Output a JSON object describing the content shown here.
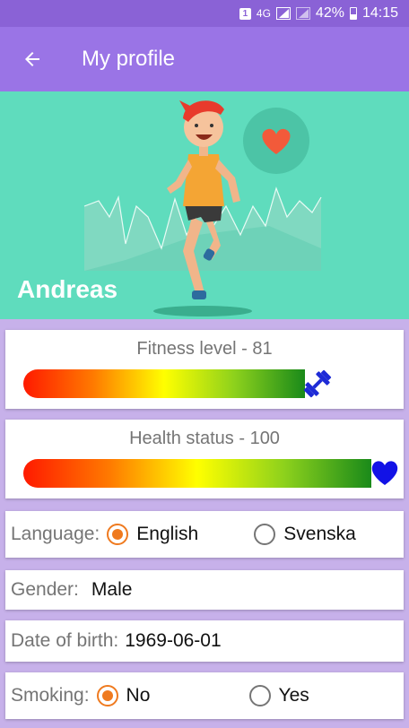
{
  "status_bar": {
    "sim": "1",
    "network": "4G",
    "battery": "42%",
    "time": "14:15"
  },
  "app_bar": {
    "title": "My profile"
  },
  "hero": {
    "name": "Andreas"
  },
  "fitness": {
    "label": "Fitness level - 81",
    "value": 81,
    "max": 100
  },
  "health": {
    "label": "Health status - 100",
    "value": 100,
    "max": 100
  },
  "language": {
    "label": "Language:",
    "options": [
      "English",
      "Svenska"
    ],
    "selected": "English"
  },
  "gender": {
    "label": "Gender:",
    "value": "Male"
  },
  "birth": {
    "label": "Date of birth:",
    "value": "1969-06-01"
  },
  "smoking": {
    "label": "Smoking:",
    "options": [
      "No",
      "Yes"
    ],
    "selected": "No"
  },
  "colors": {
    "primary": "#9a74e6",
    "accent": "#ef7a1f",
    "hero": "#5fdcbd"
  }
}
